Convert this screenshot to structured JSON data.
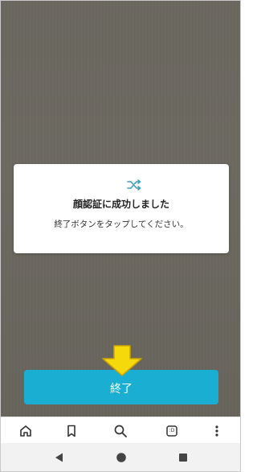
{
  "dialog": {
    "icon": "shuffle-icon",
    "title": "顔認証に成功しました",
    "message": "終了ボタンをタップしてください。"
  },
  "finish_button": {
    "label": "終了"
  },
  "annotation": {
    "arrow_color": "#f5d90a",
    "arrow_icon": "down-arrow-icon"
  },
  "toolbar": {
    "items": [
      {
        "icon": "home-icon"
      },
      {
        "icon": "bookmark-icon"
      },
      {
        "icon": "search-icon"
      },
      {
        "icon": "tabs-icon",
        "count": ":D"
      },
      {
        "icon": "more-vert-icon"
      }
    ]
  },
  "system_nav": {
    "items": [
      {
        "icon": "back-icon"
      },
      {
        "icon": "home-circle-icon"
      },
      {
        "icon": "recents-icon"
      }
    ]
  },
  "colors": {
    "accent": "#1aaed3",
    "background": "#6a675f",
    "icon_color": "#3a9fbf"
  }
}
